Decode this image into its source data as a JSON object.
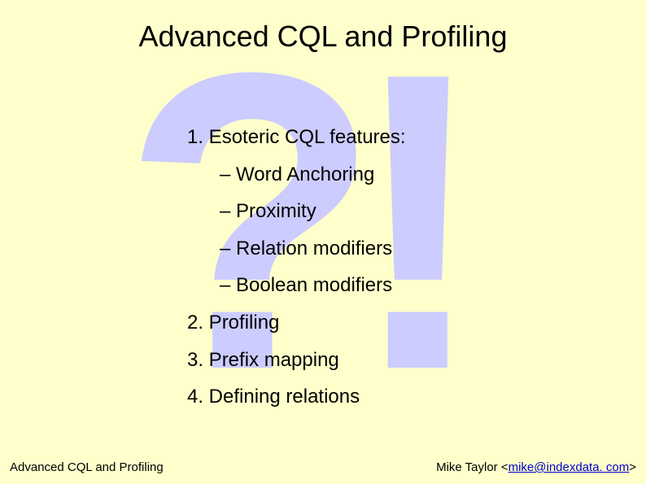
{
  "watermark": "?!",
  "title": "Advanced CQL and Profiling",
  "items": {
    "i1": "1. Esoteric CQL features:",
    "i1a": "– Word Anchoring",
    "i1b": "– Proximity",
    "i1c": "– Relation modifiers",
    "i1d": "– Boolean modifiers",
    "i2": "2. Profiling",
    "i3": "3. Prefix mapping",
    "i4": "4. Defining relations"
  },
  "footer": {
    "left": "Advanced CQL and Profiling",
    "author_name": "Mike Taylor",
    "author_prefix": " <",
    "author_email": "mike@indexdata. com",
    "author_suffix": ">"
  }
}
